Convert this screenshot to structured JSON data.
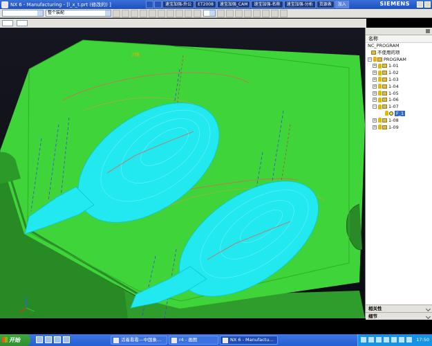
{
  "titlebar": {
    "title": "NX 6 - Manufacturing - [l_x_t.prt (修改的) ]",
    "tabs": [
      "速宝加强-外公",
      "ET2008",
      "速宝加强_CAM",
      "速宝加强-名称",
      "速宝加强-分析",
      "货源表",
      "加入"
    ],
    "active_tab": "加入",
    "brand": "SIEMENS"
  },
  "toolbar": {
    "view_combo": "整个装配",
    "left_combo": ""
  },
  "viewport": {
    "label": "刀路"
  },
  "navigator": {
    "column_header": "名称",
    "root": "NC_PROGRAM",
    "unused": "不使用的项",
    "program": "PROGRAM",
    "items": [
      {
        "label": "1-01",
        "expander": "+"
      },
      {
        "label": "1-02",
        "expander": "+"
      },
      {
        "label": "1-03",
        "expander": "+"
      },
      {
        "label": "1-04",
        "expander": "+"
      },
      {
        "label": "1-05",
        "expander": "+"
      },
      {
        "label": "1-06",
        "expander": "+"
      },
      {
        "label": "1-07",
        "expander": "−"
      },
      {
        "label": "F_1",
        "expander": "",
        "selected": true,
        "indent": true
      },
      {
        "label": "1-08",
        "expander": "+"
      },
      {
        "label": "1-09",
        "expander": "+"
      }
    ],
    "footer_dependencies": "相关性",
    "footer_details": "细节"
  },
  "taskbar": {
    "start_label": "开始",
    "tasks": [
      {
        "label": "活着看看—中国象…",
        "active": false
      },
      {
        "label": "r4 - 画图",
        "active": false
      },
      {
        "label": "NX 6 - Manufactu…",
        "active": true
      }
    ],
    "clock": "17:50"
  },
  "colors": {
    "mold_green": "#3fd43a",
    "toolpath_cyan": "#22e8f0",
    "selection": "#316ac5"
  }
}
